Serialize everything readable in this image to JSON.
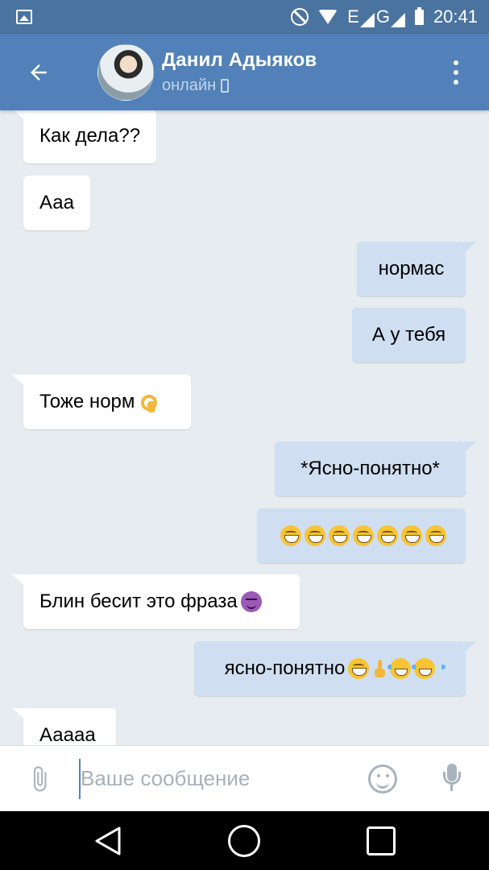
{
  "status_bar": {
    "network_label": "E",
    "network_label_2": "G",
    "time": "20:41"
  },
  "header": {
    "contact_name": "Данил Адыяков",
    "contact_status": "онлайн",
    "icons": [
      "arrow-left-icon",
      "avatar",
      "phone-icon",
      "more-vertical-icon"
    ],
    "bar_color": "#5181b8"
  },
  "messages": [
    {
      "direction": "in",
      "text": "Как дела??",
      "emoji": []
    },
    {
      "direction": "in",
      "text": "Ааа",
      "emoji": []
    },
    {
      "direction": "out",
      "text": "нормас",
      "emoji": []
    },
    {
      "direction": "out",
      "text": "А у тебя",
      "emoji": []
    },
    {
      "direction": "in",
      "text": "Тоже норм",
      "emoji": [
        "ok-hand"
      ]
    },
    {
      "direction": "out",
      "text": "*Ясно-понятно*",
      "emoji": []
    },
    {
      "direction": "out",
      "text": "",
      "emoji": [
        "grin",
        "grin",
        "grin",
        "grin",
        "grin",
        "grin",
        "grin"
      ]
    },
    {
      "direction": "in",
      "text": "Блин бесит это фраза",
      "emoji": [
        "smiling-imp"
      ]
    },
    {
      "direction": "out",
      "text": "ясно-понятно",
      "emoji": [
        "grin",
        "point-up",
        "joy",
        "joy"
      ]
    },
    {
      "direction": "in",
      "text": "Ааааа",
      "emoji": []
    }
  ],
  "input": {
    "placeholder": "Ваше сообщение",
    "value": ""
  },
  "colors": {
    "incoming_bubble": "#ffffff",
    "outgoing_bubble": "#cfdff1",
    "chat_background": "#e7ecf1"
  }
}
